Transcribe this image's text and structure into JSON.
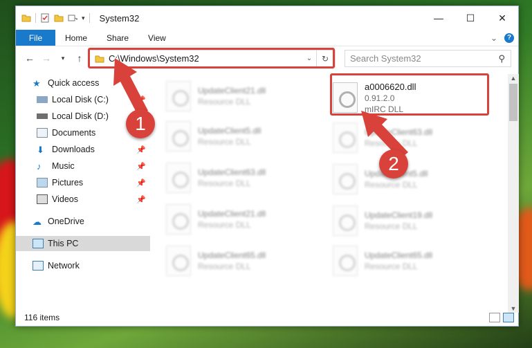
{
  "window": {
    "title": "System32",
    "controls": {
      "minimize": "—",
      "maximize": "☐",
      "close": "✕"
    }
  },
  "ribbon": {
    "file_tab": "File",
    "tabs": [
      "Home",
      "Share",
      "View"
    ],
    "expand_label": "⌄",
    "help_label": "?"
  },
  "address": {
    "path": "C:\\Windows\\System32",
    "search_placeholder": "Search System32"
  },
  "navigation": {
    "quick_access": "Quick access",
    "items": [
      {
        "label": "Local Disk (C:)",
        "pinned": true
      },
      {
        "label": "Local Disk (D:)",
        "pinned": false
      },
      {
        "label": "Documents",
        "pinned": true
      },
      {
        "label": "Downloads",
        "pinned": true
      },
      {
        "label": "Music",
        "pinned": true
      },
      {
        "label": "Pictures",
        "pinned": true
      },
      {
        "label": "Videos",
        "pinned": true
      }
    ],
    "onedrive": "OneDrive",
    "this_pc": "This PC",
    "network": "Network"
  },
  "files": {
    "highlighted": {
      "name": "a0006620.dll",
      "version": "0.91.2.0",
      "description": "mIRC DLL"
    },
    "left_column": [
      {
        "name": "UpdateClient21.dll",
        "type": "Resource DLL"
      },
      {
        "name": "UpdateClient5.dll",
        "type": "Resource DLL"
      },
      {
        "name": "UpdateClient63.dll",
        "type": "Resource DLL"
      },
      {
        "name": "UpdateClient21.dll",
        "type": "Resource DLL"
      },
      {
        "name": "UpdateClient65.dll",
        "type": "Resource DLL"
      }
    ],
    "right_column": [
      {
        "name": "UpdateClient63.dll",
        "type": "Resource DLL"
      },
      {
        "name": "UpdateClient5.dll",
        "type": "Resource DLL"
      },
      {
        "name": "UpdateClient19.dll",
        "type": "Resource DLL"
      },
      {
        "name": "UpdateClient65.dll",
        "type": "Resource DLL"
      }
    ]
  },
  "status": {
    "item_count": "116 items"
  },
  "annotations": {
    "step1": "1",
    "step2": "2",
    "color": "#d9423a"
  }
}
